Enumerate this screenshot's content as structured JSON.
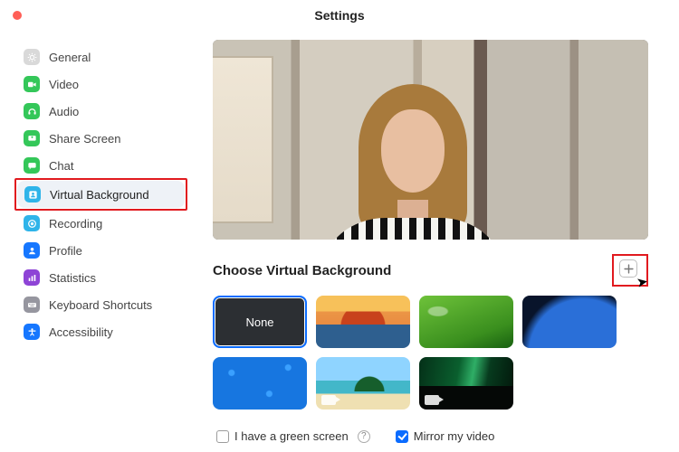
{
  "title": "Settings",
  "sidebar": {
    "items": [
      {
        "id": "general",
        "label": "General",
        "color": "#d9d9d9",
        "glyph": "gear"
      },
      {
        "id": "video",
        "label": "Video",
        "color": "#34c759",
        "glyph": "camera"
      },
      {
        "id": "audio",
        "label": "Audio",
        "color": "#34c759",
        "glyph": "headset"
      },
      {
        "id": "share-screen",
        "label": "Share Screen",
        "color": "#34c759",
        "glyph": "screen"
      },
      {
        "id": "chat",
        "label": "Chat",
        "color": "#34c759",
        "glyph": "chat"
      },
      {
        "id": "virtual-background",
        "label": "Virtual Background",
        "color": "#2fb4e9",
        "glyph": "person",
        "selected": true,
        "highlighted": true
      },
      {
        "id": "recording",
        "label": "Recording",
        "color": "#2fb4e9",
        "glyph": "record"
      },
      {
        "id": "profile",
        "label": "Profile",
        "color": "#1677ff",
        "glyph": "avatar"
      },
      {
        "id": "statistics",
        "label": "Statistics",
        "color": "#8e44d6",
        "glyph": "bars"
      },
      {
        "id": "keyboard-shortcuts",
        "label": "Keyboard Shortcuts",
        "color": "#96969f",
        "glyph": "keyboard"
      },
      {
        "id": "accessibility",
        "label": "Accessibility",
        "color": "#1677ff",
        "glyph": "accessibility"
      }
    ]
  },
  "main": {
    "section_title": "Choose Virtual Background",
    "add_highlighted": true,
    "backgrounds": [
      {
        "id": "none",
        "label": "None",
        "selected": true
      },
      {
        "id": "bridge",
        "kind": "image"
      },
      {
        "id": "grass",
        "kind": "image"
      },
      {
        "id": "space",
        "kind": "image"
      },
      {
        "id": "blue",
        "kind": "image"
      },
      {
        "id": "beach",
        "kind": "video"
      },
      {
        "id": "aurora",
        "kind": "video"
      }
    ],
    "options": {
      "green_screen_label": "I have a green screen",
      "green_screen_checked": false,
      "mirror_label": "Mirror my video",
      "mirror_checked": true
    }
  }
}
